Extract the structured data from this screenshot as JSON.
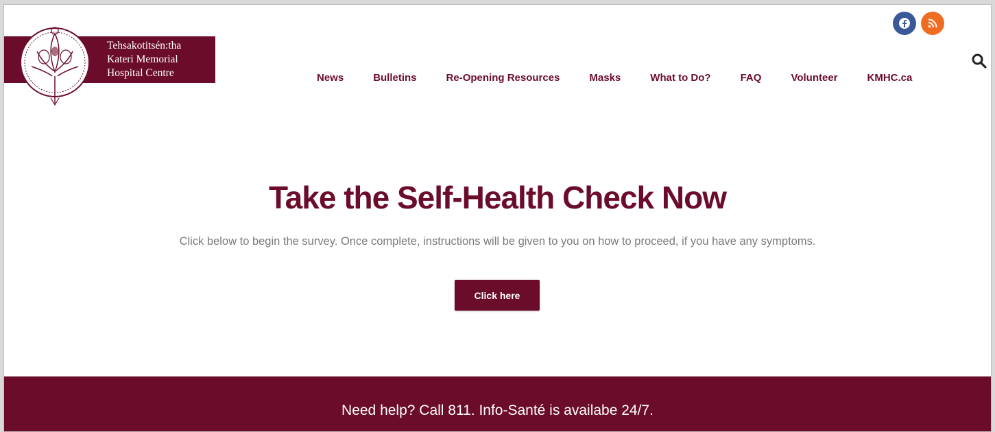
{
  "brand": {
    "name_lines": [
      "Tehsakotitsén:tha",
      "Kateri Memorial",
      "Hospital Centre"
    ],
    "color": "#6b0d2a",
    "emblem_icon": "feather-emblem-icon"
  },
  "social": [
    {
      "name": "facebook",
      "icon": "facebook-icon",
      "color": "#3b5998"
    },
    {
      "name": "rss",
      "icon": "rss-icon",
      "color": "#f06c21"
    }
  ],
  "search_icon": "search-icon",
  "nav": {
    "items": [
      {
        "label": "News"
      },
      {
        "label": "Bulletins"
      },
      {
        "label": "Re-Opening Resources"
      },
      {
        "label": "Masks"
      },
      {
        "label": "What to Do?"
      },
      {
        "label": "FAQ"
      },
      {
        "label": "Volunteer"
      },
      {
        "label": "KMHC.ca"
      }
    ]
  },
  "hero": {
    "title": "Take the Self-Health Check Now",
    "subtitle": "Click below to begin the survey. Once complete, instructions will be given to you on how to proceed, if you have any symptoms.",
    "button_label": "Click here"
  },
  "help_bar": {
    "text": "Need help? Call 811. Info-Santé is availabe 24/7."
  }
}
